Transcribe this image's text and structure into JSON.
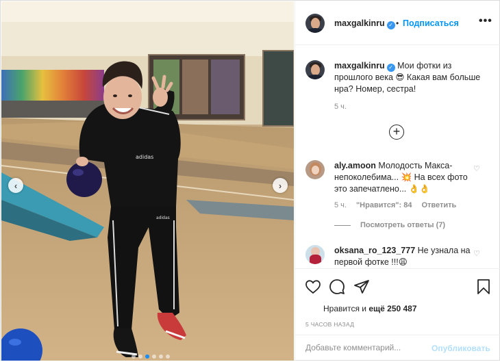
{
  "post": {
    "author": "maxgalkinru",
    "follow_label": "Подписаться",
    "separator": "•",
    "more_label": "•••",
    "caption_text": "Мои фотки из прошлого века 😎 Какая вам больше нра? Номер, сестра!",
    "caption_time": "5 ч.",
    "carousel": {
      "slides": 6,
      "active_index": 2
    }
  },
  "comments": [
    {
      "user": "aly.amoon",
      "text": "Молодость Макса-непоколебима... 💥 На всех фото это запечатлено... 👌👌",
      "time": "5 ч.",
      "likes": "\"Нравится\": 84",
      "reply_label": "Ответить",
      "view_replies": "Посмотреть ответы (7)"
    },
    {
      "user": "oksana_ro_123_777",
      "text": "Не узнала на первой фотке !!!😩"
    }
  ],
  "footer": {
    "likes_prefix": "Нравится",
    "likes_middle": "",
    "likes_and": "и",
    "likes_more": "ещё 250 487",
    "posted_ago": "5 ЧАСОВ НАЗАД",
    "comment_placeholder": "Добавьте комментарий...",
    "publish_label": "Опубликовать"
  },
  "icons": {
    "prev": "chevron-left-icon",
    "next": "chevron-right-icon",
    "like": "heart-icon",
    "comment": "comment-bubble-icon",
    "share": "paper-plane-icon",
    "save": "bookmark-icon",
    "add": "plus-circle-icon",
    "verified": "verified-badge-icon"
  },
  "colors": {
    "link": "#0095f6",
    "verified": "#3897f0",
    "muted": "#8e8e8e",
    "publish_disabled": "#b2dffc"
  }
}
